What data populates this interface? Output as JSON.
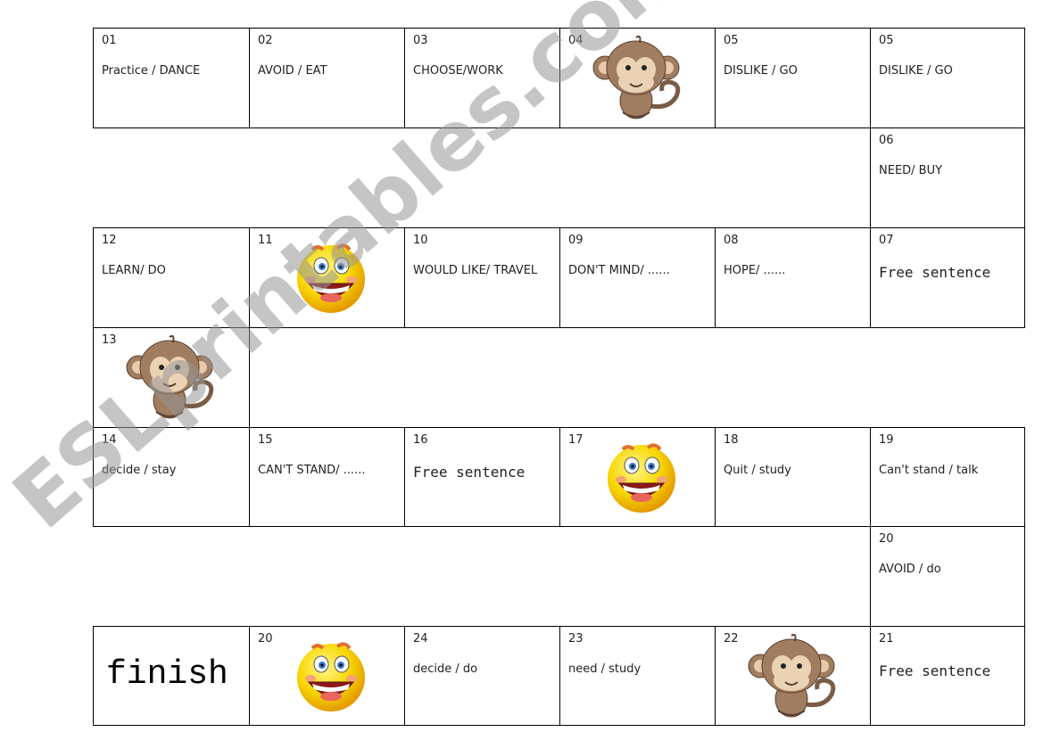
{
  "cells": [
    {
      "num": "01",
      "text": "Practice / DANCE"
    },
    {
      "num": "02",
      "text": "AVOID / EAT"
    },
    {
      "num": "03",
      "text": "CHOOSE/WORK"
    },
    {
      "num": "04",
      "text": "",
      "icon": "monkey-icon"
    },
    {
      "num": "05",
      "text": "DISLIKE / GO"
    },
    {
      "num": "05",
      "text": "DISLIKE / GO"
    },
    {
      "num": "06",
      "text": "NEED/ BUY"
    },
    {
      "num": "07",
      "text": "Free sentence"
    },
    {
      "num": "08",
      "text": "HOPE/ ......"
    },
    {
      "num": "09",
      "text": "DON'T MIND/ ......"
    },
    {
      "num": "10",
      "text": "WOULD LIKE/ TRAVEL"
    },
    {
      "num": "11",
      "text": "",
      "icon": "smiley-icon"
    },
    {
      "num": "12",
      "text": "LEARN/ DO"
    },
    {
      "num": "13",
      "text": "",
      "icon": "monkey-icon"
    },
    {
      "num": "14",
      "text": "decide / stay"
    },
    {
      "num": "15",
      "text": "CAN'T STAND/ ......"
    },
    {
      "num": "16",
      "text": "Free sentence"
    },
    {
      "num": "17",
      "text": "",
      "icon": "smiley-icon"
    },
    {
      "num": "18",
      "text": "Quit / study"
    },
    {
      "num": "19",
      "text": " Can't stand / talk"
    },
    {
      "num": "20",
      "text": "AVOID / do"
    },
    {
      "num": "21",
      "text": "Free sentence"
    },
    {
      "num": "22",
      "text": "",
      "icon": "monkey-icon"
    },
    {
      "num": "23",
      "text": "need / study"
    },
    {
      "num": "24",
      "text": "decide / do"
    },
    {
      "num": "20",
      "text": "",
      "icon": "smiley-icon"
    }
  ],
  "finish": "finish",
  "watermark": "ESLprintables.com"
}
